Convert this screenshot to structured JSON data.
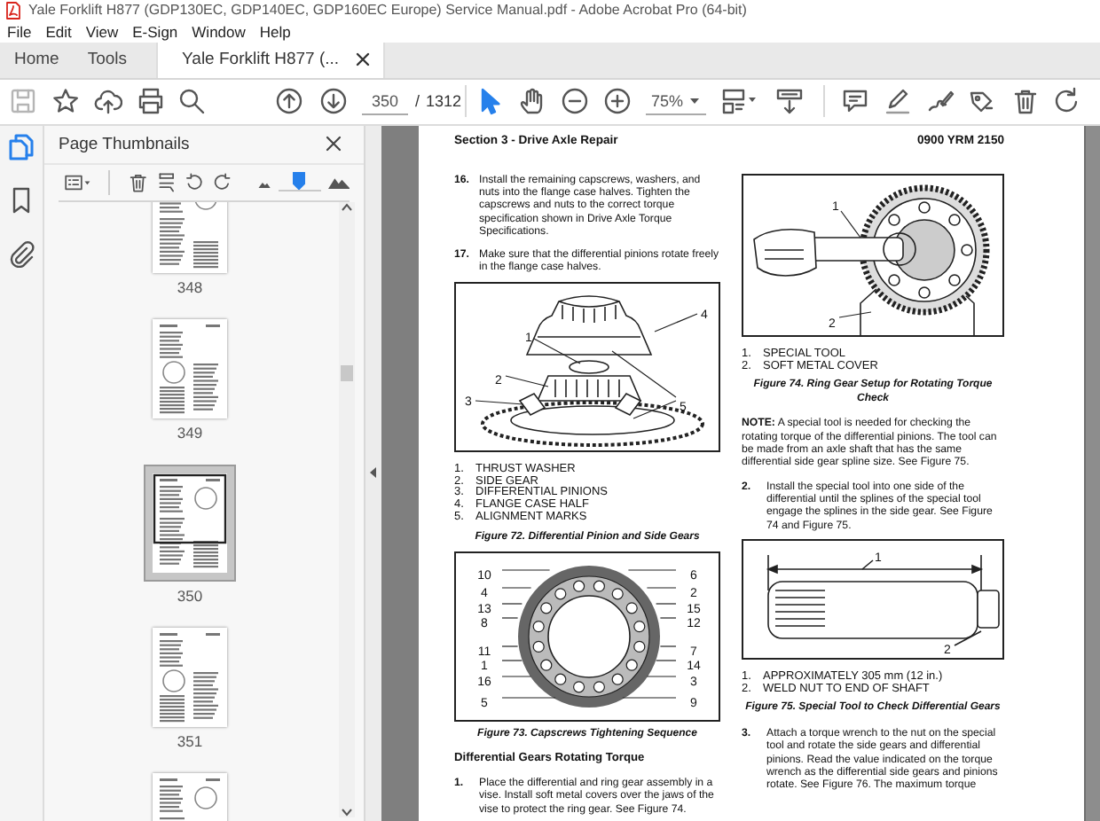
{
  "window": {
    "title": "Yale Forklift H877 (GDP130EC, GDP140EC, GDP160EC Europe) Service Manual.pdf - Adobe Acrobat Pro (64-bit)"
  },
  "menu": [
    "File",
    "Edit",
    "View",
    "E-Sign",
    "Window",
    "Help"
  ],
  "tabs": [
    {
      "label": "Home",
      "selected": false,
      "closable": false
    },
    {
      "label": "Tools",
      "selected": false,
      "closable": false
    },
    {
      "label": "Yale Forklift H877 (...",
      "selected": true,
      "closable": true
    }
  ],
  "toolbar": {
    "page": "350",
    "page_separator": "/",
    "page_count": "1312",
    "zoom": "75%"
  },
  "side_rail": {
    "items": [
      {
        "selected": true
      },
      {
        "selected": false
      },
      {
        "selected": false
      }
    ]
  },
  "side_panel": {
    "title": "Page Thumbnails",
    "thumbnail_size": {
      "level": 0.5
    },
    "thumbnails": [
      {
        "label": "348",
        "selected": false
      },
      {
        "label": "349",
        "selected": false
      },
      {
        "label": "350",
        "selected": true
      },
      {
        "label": "351",
        "selected": false
      },
      {
        "selected": false
      }
    ]
  },
  "document": {
    "header_left": "Section 3 - Drive Axle Repair",
    "header_right": "0900 YRM 2150",
    "columns": [
      [
        {
          "kind": "step",
          "number": "16.",
          "text": "Install the remaining capscrews, washers, and nuts into the flange case halves. Tighten the capscrews and nuts to the correct torque specification shown in Drive Axle Torque Specifications."
        },
        {
          "kind": "step",
          "number": "17.",
          "text": "Make sure that the differential pinions rotate freely in the flange case halves."
        },
        {
          "kind": "figure",
          "callouts": [
            "1",
            "2",
            "3",
            "4",
            "5"
          ]
        },
        {
          "kind": "legend",
          "items": [
            {
              "number": "1.",
              "text": "THRUST WASHER"
            },
            {
              "number": "2.",
              "text": "SIDE GEAR"
            },
            {
              "number": "3.",
              "text": "DIFFERENTIAL PINIONS"
            },
            {
              "number": "4.",
              "text": "FLANGE CASE HALF"
            },
            {
              "number": "5.",
              "text": "ALIGNMENT MARKS"
            }
          ]
        },
        {
          "kind": "caption",
          "text": "Figure 72. Differential Pinion and Side Gears"
        },
        {
          "kind": "figure",
          "callouts": [
            "10",
            "4",
            "13",
            "8",
            "11",
            "1",
            "16",
            "5",
            "6",
            "2",
            "15",
            "12",
            "7",
            "14",
            "3",
            "9"
          ]
        },
        {
          "kind": "caption",
          "text": "Figure 73. Capscrews Tightening Sequence"
        },
        {
          "kind": "heading",
          "text": "Differential Gears Rotating Torque"
        },
        {
          "kind": "step",
          "number": "1.",
          "text": "Place the differential and ring gear assembly in a vise. Install soft metal covers over the jaws of the vise to protect the ring gear. See Figure 74."
        }
      ],
      [
        {
          "kind": "figure",
          "callouts": [
            "1",
            "2"
          ]
        },
        {
          "kind": "legend",
          "items": [
            {
              "number": "1.",
              "text": "SPECIAL TOOL"
            },
            {
              "number": "2.",
              "text": "SOFT METAL COVER"
            }
          ]
        },
        {
          "kind": "caption",
          "text": "Figure 74. Ring Gear Setup for Rotating Torque Check"
        },
        {
          "kind": "note",
          "text": "**NOTE:** A special tool is needed for checking the rotating torque of the differential pinions. The tool can be made from an axle shaft that has the same differential side gear spline size. See Figure 75."
        },
        {
          "kind": "step",
          "number": "2.",
          "text": "Install the special tool into one side of the differential until the splines of the special tool engage the splines in the side gear. See Figure 74 and Figure 75."
        },
        {
          "kind": "figure",
          "callouts": [
            "1",
            "2"
          ]
        },
        {
          "kind": "legend",
          "items": [
            {
              "number": "1.",
              "text": "APPROXIMATELY 305 mm (12 in.)"
            },
            {
              "number": "2.",
              "text": "WELD NUT TO END OF SHAFT"
            }
          ]
        },
        {
          "kind": "caption",
          "text": "Figure 75. Special Tool to Check Differential Gears"
        },
        {
          "kind": "step",
          "number": "3.",
          "text": "Attach a torque wrench to the nut on the special tool and rotate the side gears and differential pinions. Read the value indicated on the torque wrench as the differential side gears and pinions rotate. See Figure 76. The maximum torque"
        }
      ]
    ]
  }
}
